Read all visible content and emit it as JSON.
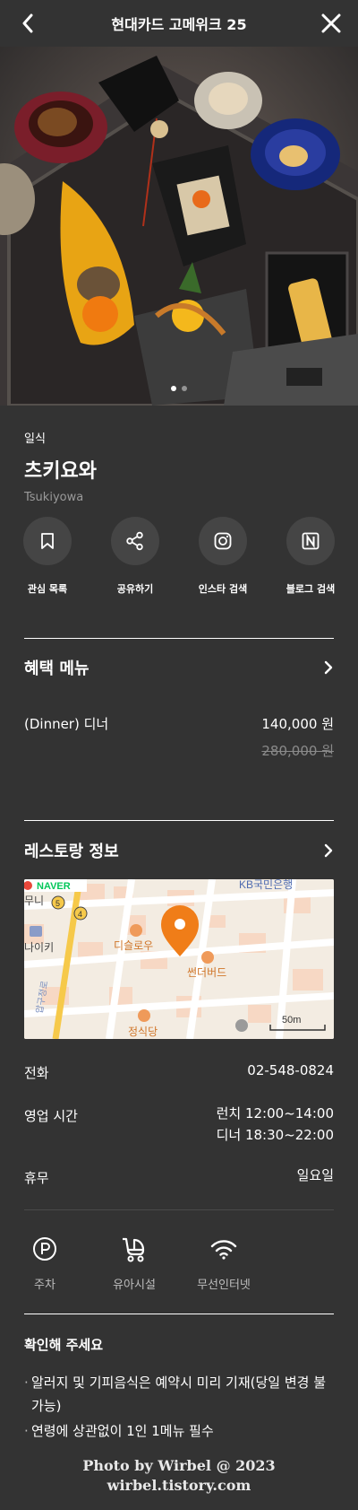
{
  "header": {
    "title": "현대카드 고메위크 25"
  },
  "carousel": {
    "page": 1,
    "total": 2
  },
  "restaurant": {
    "cuisine": "일식",
    "name": "츠키요와",
    "name_en": "Tsukiyowa"
  },
  "actions": [
    {
      "label": "관심 목록",
      "icon": "bookmark-icon"
    },
    {
      "label": "공유하기",
      "icon": "share-icon"
    },
    {
      "label": "인스타 검색",
      "icon": "instagram-icon"
    },
    {
      "label": "블로그 검색",
      "icon": "naver-icon"
    }
  ],
  "benefit": {
    "title": "혜택 메뉴",
    "item": {
      "name": "(Dinner)  디너",
      "price": "140,000 원",
      "original_price": "280,000 원"
    }
  },
  "restaurant_info": {
    "title": "레스토랑 정보",
    "map": {
      "brand": "NAVER",
      "labels": {
        "bank": "KB국민은행",
        "left1": "무니",
        "left2": "나이키",
        "place1": "디슬로우",
        "place2": "썬더버드",
        "place3": "정식당",
        "road": "압구정로",
        "scale": "50m",
        "num5": "5",
        "num4": "4"
      }
    },
    "phone_label": "전화",
    "phone": "02-548-0824",
    "hours_label": "영업 시간",
    "hours_lunch": "런치 12:00~14:00",
    "hours_dinner": "디너 18:30~22:00",
    "closed_label": "휴무",
    "closed": "일요일"
  },
  "amenities": [
    {
      "label": "주차",
      "icon": "parking-icon"
    },
    {
      "label": "유아시설",
      "icon": "stroller-icon"
    },
    {
      "label": "무선인터넷",
      "icon": "wifi-icon"
    }
  ],
  "notice": {
    "title": "확인해 주세요",
    "items": [
      "알러지 및 기피음식은 예약시 미리 기재(당일 변경 불가능)",
      "연령에 상관없이 1인 1메뉴 필수"
    ]
  },
  "watermark": {
    "line1": "Photo by Wirbel @ 2023",
    "line2": "wirbel.tistory.com"
  },
  "colors": {
    "background": "#333333",
    "accent_pin": "#f07d18",
    "naver_green": "#03c75a"
  }
}
